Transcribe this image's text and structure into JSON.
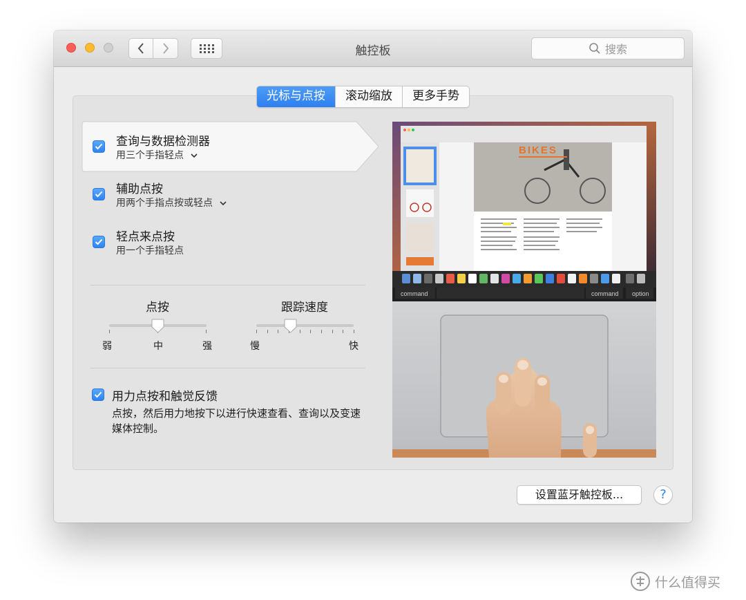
{
  "window": {
    "title": "触控板"
  },
  "search": {
    "placeholder": "搜索"
  },
  "tabs": [
    {
      "label": "光标与点按",
      "active": true
    },
    {
      "label": "滚动缩放",
      "active": false
    },
    {
      "label": "更多手势",
      "active": false
    }
  ],
  "options": [
    {
      "title": "查询与数据检测器",
      "subtitle": "用三个手指轻点",
      "checked": true,
      "has_dropdown": true,
      "selected": true
    },
    {
      "title": "辅助点按",
      "subtitle": "用两个手指点按或轻点",
      "checked": true,
      "has_dropdown": true,
      "selected": false
    },
    {
      "title": "轻点来点按",
      "subtitle": "用一个手指轻点",
      "checked": true,
      "has_dropdown": false,
      "selected": false
    }
  ],
  "click_slider": {
    "title": "点按",
    "labels": [
      "弱",
      "中",
      "强"
    ],
    "value": "中"
  },
  "tracking_slider": {
    "title": "跟踪速度",
    "labels": [
      "慢",
      "快"
    ],
    "value_fraction": 0.35
  },
  "force_click": {
    "title": "用力点按和触觉反馈",
    "checked": true,
    "description": "点按，然后用力地按下以进行快速查看、查询以及变速媒体控制。"
  },
  "preview": {
    "poster_title": "BIKES",
    "keys": [
      "command",
      "command",
      "option"
    ]
  },
  "footer": {
    "bluetooth_button": "设置蓝牙触控板...",
    "help_label": "?"
  },
  "watermark": {
    "text": "什么值得买"
  },
  "colors": {
    "accent": "#2f7ff0",
    "window_bg": "#ececec",
    "panel_bg": "#e3e3e3"
  }
}
